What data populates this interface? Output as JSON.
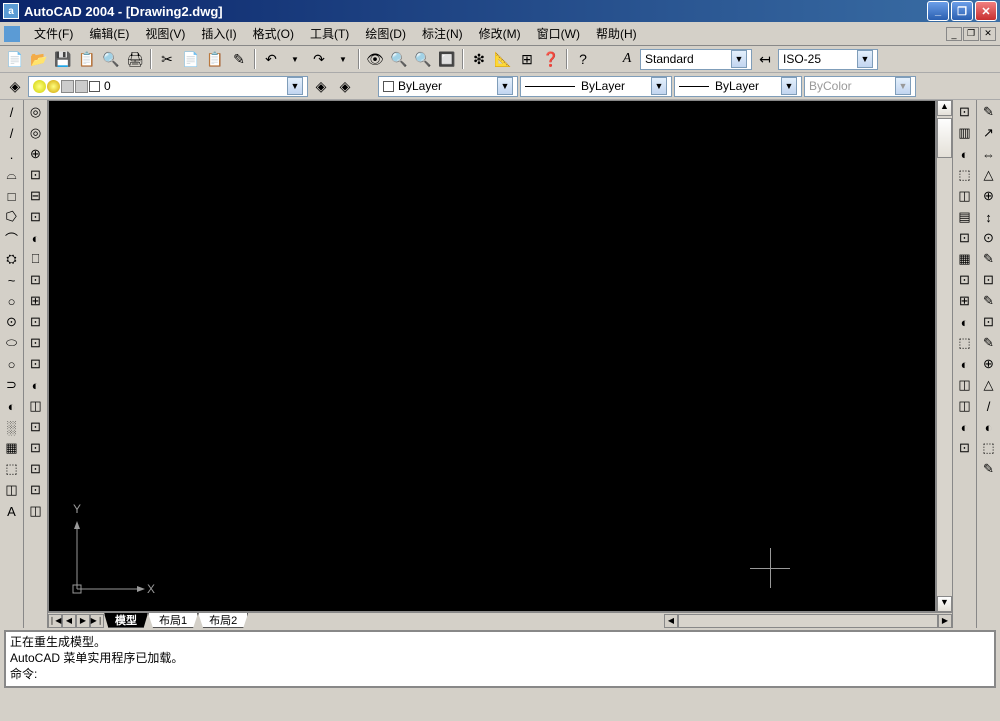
{
  "titlebar": {
    "title": "AutoCAD 2004 - [Drawing2.dwg]",
    "min": "_",
    "max": "❐",
    "close": "✕"
  },
  "menu": {
    "items": [
      {
        "label": "文件(F)"
      },
      {
        "label": "编辑(E)"
      },
      {
        "label": "视图(V)"
      },
      {
        "label": "插入(I)"
      },
      {
        "label": "格式(O)"
      },
      {
        "label": "工具(T)"
      },
      {
        "label": "绘图(D)"
      },
      {
        "label": "标注(N)"
      },
      {
        "label": "修改(M)"
      },
      {
        "label": "窗口(W)"
      },
      {
        "label": "帮助(H)"
      }
    ],
    "mdi": {
      "min": "_",
      "restore": "❐",
      "close": "✕"
    }
  },
  "toolbar1": {
    "icons": [
      "📄",
      "📂",
      "💾",
      "📋",
      "🔍",
      "🖨",
      "✂",
      "📄",
      "📋",
      "✎",
      "↶",
      "↷",
      "✎",
      "👁",
      "🔍",
      "🔍",
      "🔲",
      "❇",
      "📐",
      "⊞",
      "❓",
      "?"
    ]
  },
  "textstyle": {
    "icon": "A",
    "value": "Standard"
  },
  "dimstyle": {
    "icon": "↤",
    "value": "ISO-25"
  },
  "layers": {
    "layer_label": "0",
    "linetype": "ByLayer",
    "color": "ByLayer",
    "lineweight": "ByLayer",
    "plotstyle": "ByColor"
  },
  "left_tools1": [
    "/",
    "/",
    ".",
    "⌓",
    "□",
    "⭔",
    "⌒",
    "⛭",
    "~",
    "○",
    "⊙",
    "⬭",
    "○",
    "⊃",
    "◐",
    "░",
    "▦",
    "⬚",
    "◫",
    "A"
  ],
  "left_tools2": [
    "◎",
    "◎",
    "⊕",
    "⊡",
    "⊟",
    "⊡",
    "◐",
    "⎕",
    "⊡",
    "⊞",
    "⊡",
    "⊡",
    "⊡",
    "◐",
    "◫",
    "⊡",
    "⊡",
    "⊡",
    "⊡",
    "◫"
  ],
  "left_bottom": [
    "△",
    "◐",
    "◇",
    "◈",
    "◇"
  ],
  "right_tools1": [
    "⊡",
    "▥",
    "◐",
    "⬚",
    "◫",
    "▤",
    "⊡",
    "▦",
    "⊡",
    "⊞",
    "◐",
    "⬚",
    "◐",
    "◫",
    "◫",
    "◐",
    "⊡"
  ],
  "right_tools2": [
    "✎",
    "↗",
    "⇔",
    "△",
    "⊕",
    "↕",
    "⊙",
    "✎",
    "⊡",
    "✎",
    "⊡",
    "✎",
    "⊕",
    "△",
    "/",
    "◐",
    "⬚",
    "✎"
  ],
  "tabs": {
    "nav": [
      "❘◀",
      "◀",
      "▶",
      "▶❘"
    ],
    "items": [
      {
        "label": "模型",
        "active": true
      },
      {
        "label": "布局1",
        "active": false
      },
      {
        "label": "布局2",
        "active": false
      }
    ]
  },
  "ucs": {
    "x_label": "X",
    "y_label": "Y"
  },
  "command": {
    "line1": "正在重生成模型。",
    "line2": "AutoCAD 菜单实用程序已加载。",
    "prompt": "命令:"
  }
}
